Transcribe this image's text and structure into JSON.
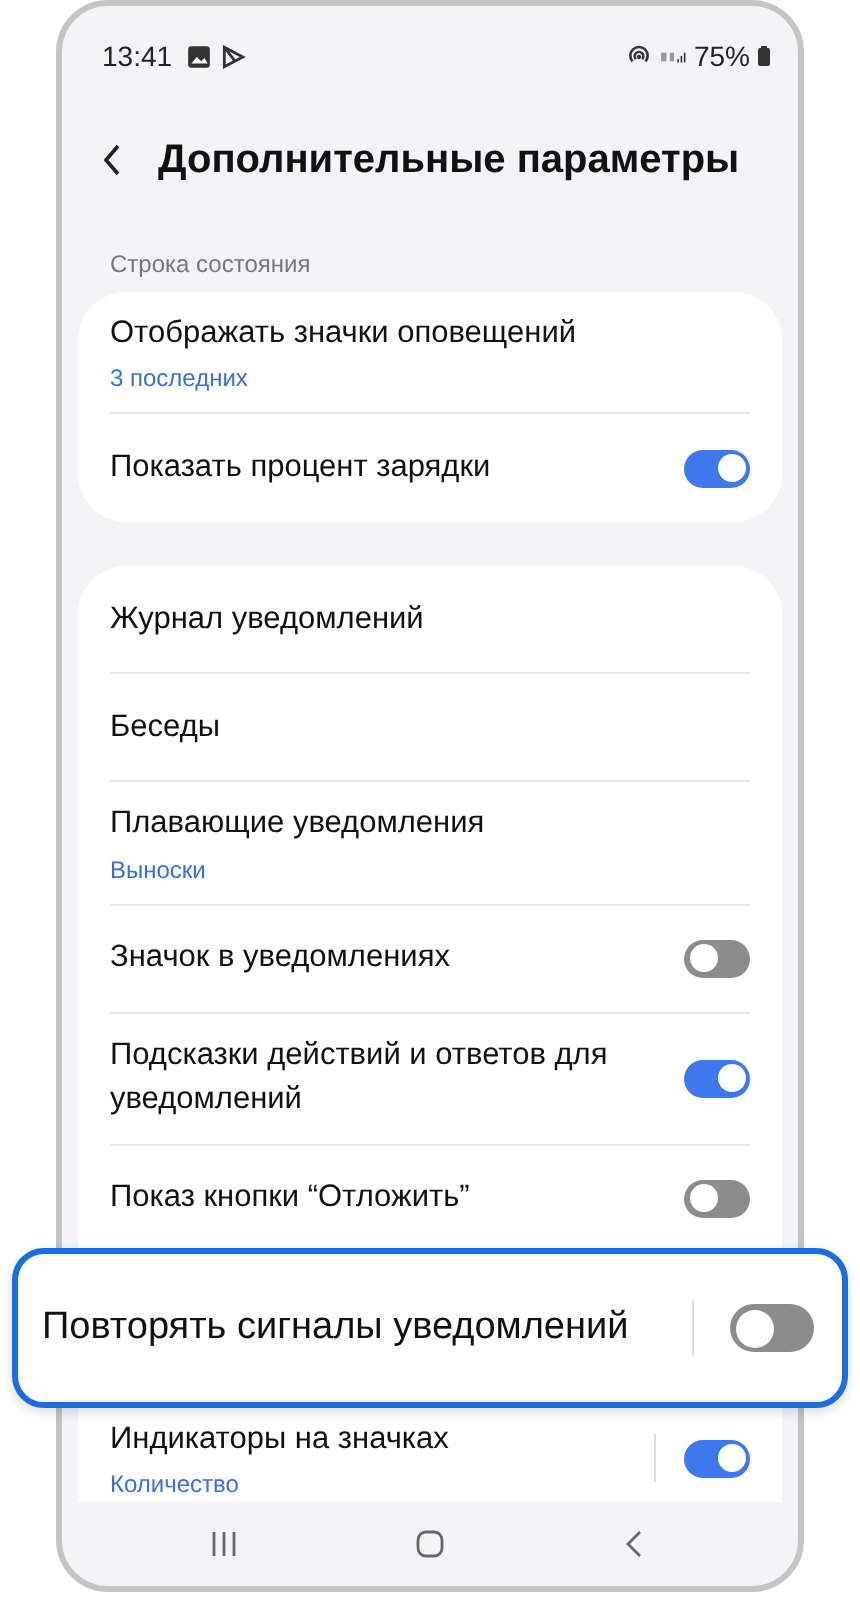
{
  "status_bar": {
    "time": "13:41",
    "battery": "75%"
  },
  "header": {
    "title": "Дополнительные параметры"
  },
  "section_label": "Строка состояния",
  "card_1": [
    {
      "kind": "link",
      "label": "Отображать значки оповещений",
      "sub": "3 последних"
    },
    {
      "kind": "toggle",
      "label": "Показать процент зарядки",
      "on": true
    }
  ],
  "card_2": [
    {
      "kind": "link",
      "label": "Журнал уведомлений"
    },
    {
      "kind": "link",
      "label": "Беседы"
    },
    {
      "kind": "link",
      "label": "Плавающие уведомления",
      "sub": "Выноски"
    },
    {
      "kind": "toggle",
      "label": "Значок в уведомлениях",
      "on": false
    },
    {
      "kind": "toggle",
      "label": "Подсказки действий и ответов для уведомлений",
      "on": true
    },
    {
      "kind": "toggle",
      "label": "Показ кнопки “Отложить”",
      "on": false
    },
    {
      "kind": "hidden"
    },
    {
      "kind": "split-toggle",
      "label": "Индикаторы на значках",
      "sub": "Количество",
      "on": true
    }
  ],
  "callout": {
    "label": "Повторять сигналы уведомлений",
    "on": false
  }
}
